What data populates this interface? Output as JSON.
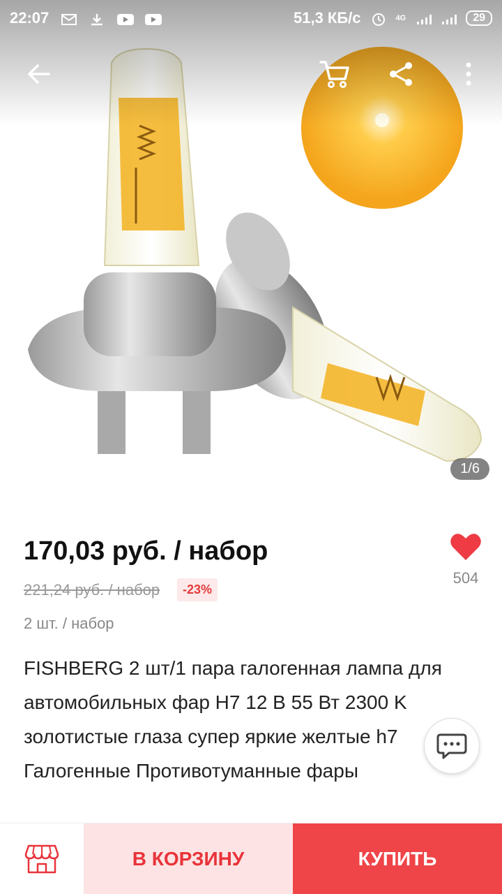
{
  "status_bar": {
    "time": "22:07",
    "net_speed": "51,3 КБ/с",
    "network": "4G",
    "battery": "29"
  },
  "gallery": {
    "counter": "1/6",
    "image_icon": "halogen-bulb-image"
  },
  "product": {
    "price": "170,03 руб. / набор",
    "old_price": "221,24 руб. / набор",
    "discount": "-23%",
    "per_set": "2 шт. / набор",
    "favorites_count": "504",
    "title": "FISHBERG 2 шт/1 пара галогенная лампа для автомобильных фар H7 12 В 55 Вт 2300 K золотистые глаза супер яркие желтые h7 Галогенные Противотуманные фары"
  },
  "actions": {
    "add_to_cart": "В КОРЗИНУ",
    "buy": "КУПИТЬ"
  },
  "colors": {
    "accent": "#ef4448",
    "cart_bg": "#fde3e3",
    "heart": "#ee3b44"
  }
}
